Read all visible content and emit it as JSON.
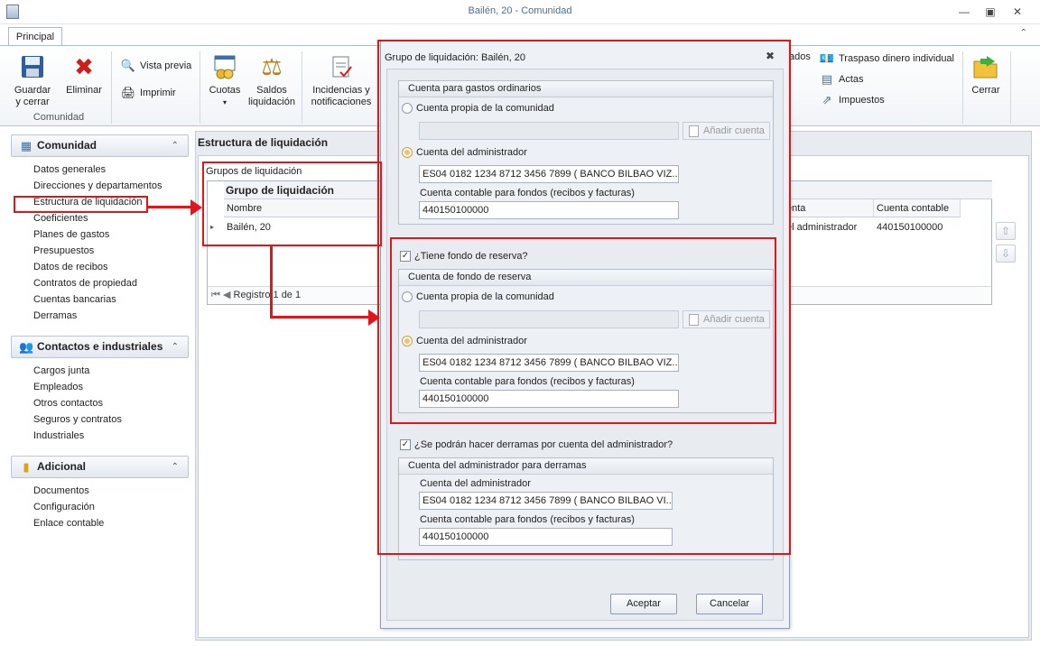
{
  "window": {
    "title": "Bailén, 20 - Comunidad"
  },
  "ribbon": {
    "tab": "Principal",
    "guardar": "Guardar y cerrar",
    "eliminar": "Eliminar",
    "vista_previa": "Vista previa",
    "imprimir": "Imprimir",
    "group_comunidad": "Comunidad",
    "cuotas": "Cuotas",
    "saldos": "Saldos liquidación",
    "incidencias": "Incidencias y notificaciones",
    "ados": "ados",
    "traspaso": "Traspaso dinero individual",
    "actas": "Actas",
    "impuestos": "Impuestos",
    "cerrar": "Cerrar"
  },
  "nav": {
    "comunidad": {
      "title": "Comunidad",
      "items": [
        "Datos generales",
        "Direcciones y departamentos",
        "Estructura de liquidación",
        "Coeficientes",
        "Planes de gastos",
        "Presupuestos",
        "Datos de recibos",
        "Contratos de propiedad",
        "Cuentas bancarias",
        "Derramas"
      ]
    },
    "contactos": {
      "title": "Contactos e industriales",
      "items": [
        "Cargos junta",
        "Empleados",
        "Otros contactos",
        "Seguros y contratos",
        "Industriales"
      ]
    },
    "adicional": {
      "title": "Adicional",
      "items": [
        "Documentos",
        "Configuración",
        "Enlace contable"
      ]
    }
  },
  "main": {
    "header": "Estructura de liquidación",
    "grid_label": "Grupos de liquidación",
    "band": "Grupo de liquidación",
    "col_nombre": "Nombre",
    "col_cuenta": "enta",
    "col_cuenta_contable": "Cuenta contable",
    "row_nombre": "Bailén, 20",
    "row_cuenta": "el administrador",
    "row_cuenta_contable": "440150100000",
    "pager": "Registro 1 de 1"
  },
  "dialog": {
    "title": "Grupo de liquidación: Bailén, 20",
    "ordinarios": {
      "title": "Cuenta para gastos ordinarios",
      "opt_propia": "Cuenta propia de la comunidad",
      "btn_add": "Añadir cuenta",
      "opt_admin": "Cuenta del administrador",
      "cuenta": "ES04 0182 1234 8712 3456 7899 ( BANCO BILBAO VIZ...",
      "label_contable": "Cuenta contable para fondos (recibos y facturas)",
      "contable": "440150100000"
    },
    "reserva": {
      "check": "¿Tiene fondo de reserva?",
      "title": "Cuenta de fondo de reserva",
      "opt_propia": "Cuenta propia de la comunidad",
      "btn_add": "Añadir cuenta",
      "opt_admin": "Cuenta del administrador",
      "cuenta": "ES04 0182 1234 8712 3456 7899 ( BANCO BILBAO VIZ...",
      "label_contable": "Cuenta contable para fondos (recibos y facturas)",
      "contable": "440150100000"
    },
    "derramas": {
      "check": "¿Se podrán hacer derramas por cuenta del administrador?",
      "title": "Cuenta del administrador para derramas",
      "label_cuenta": "Cuenta del administrador",
      "cuenta": "ES04 0182 1234 8712 3456 7899 ( BANCO BILBAO VI...",
      "label_contable": "Cuenta contable para fondos (recibos y facturas)",
      "contable": "440150100000"
    },
    "aceptar": "Aceptar",
    "cancelar": "Cancelar"
  },
  "colors": {
    "annotation": "#e2151b",
    "title_text": "#4d6d9a"
  }
}
